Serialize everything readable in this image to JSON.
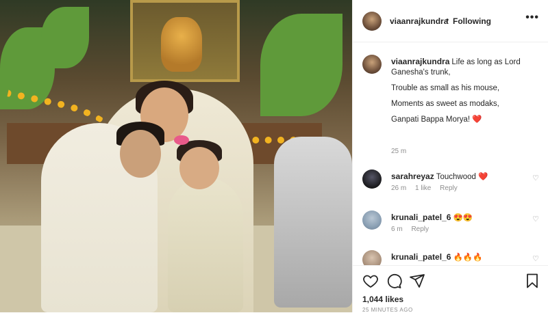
{
  "header": {
    "username": "viaanrajkundra",
    "separator": "•",
    "follow_status": "Following",
    "more_label": "•••"
  },
  "caption": {
    "username": "viaanrajkundra",
    "lines": [
      "Life as long as Lord Ganesha's trunk,",
      "Trouble as small as his mouse,",
      "Moments as sweet as modaks,",
      "Ganpati Bappa Morya!"
    ],
    "heart": "❤️",
    "time": "25 m"
  },
  "comments": [
    {
      "username": "sarahreyaz",
      "text": "Touchwood ❤️",
      "time": "26 m",
      "likes": "1 like",
      "reply": "Reply"
    },
    {
      "username": "krunali_patel_6",
      "text": "😍😍",
      "time": "6 m",
      "likes": "",
      "reply": "Reply"
    },
    {
      "username": "krunali_patel_6",
      "text": "🔥🔥🔥",
      "time": "",
      "likes": "",
      "reply": ""
    }
  ],
  "footer": {
    "likes": "1,044 likes",
    "ago": "25 minutes ago"
  },
  "icons": [
    "heart-icon",
    "comment-icon",
    "share-icon",
    "bookmark-icon",
    "more-icon"
  ],
  "colors": {
    "heart": "#ed4956",
    "muted": "#8e8e8e",
    "text": "#262626"
  }
}
